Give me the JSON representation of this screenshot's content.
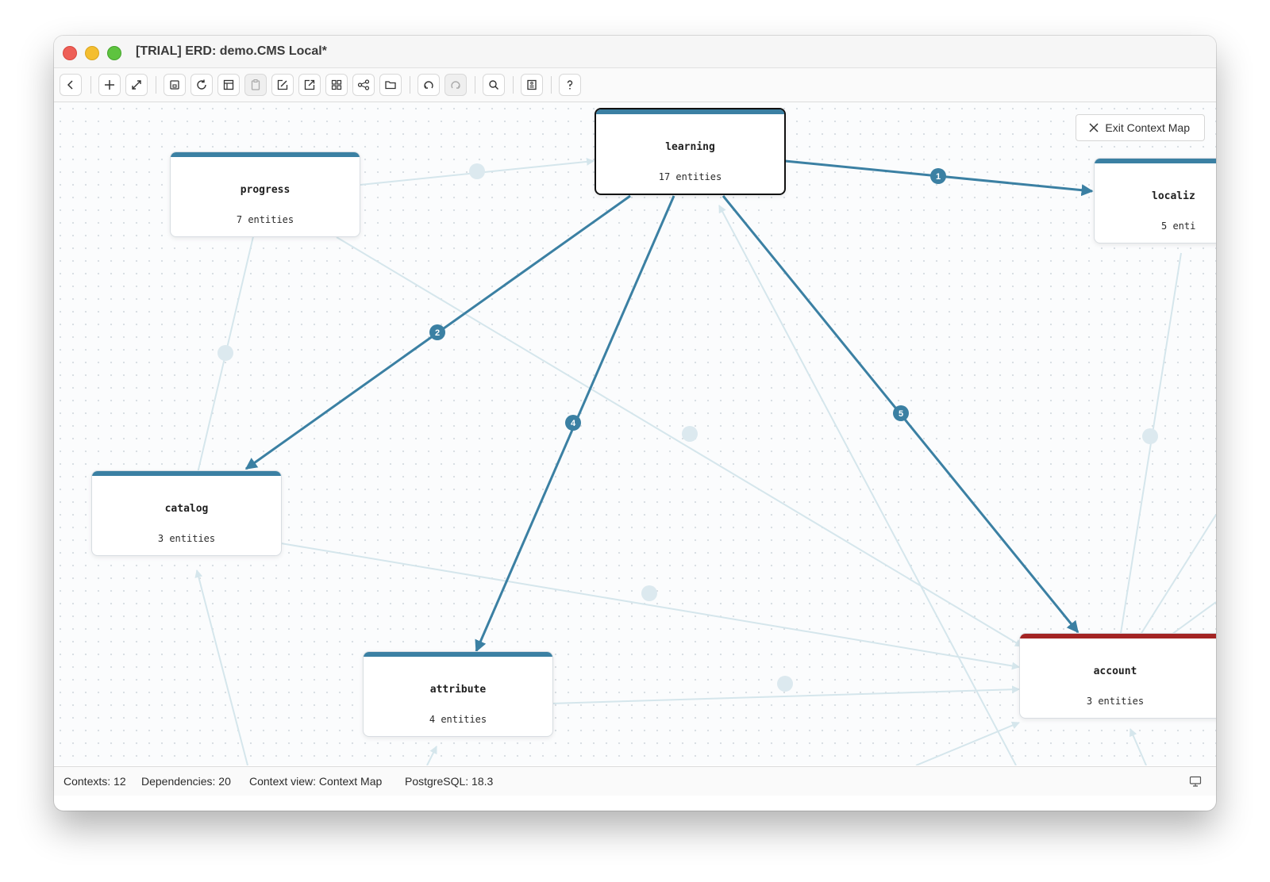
{
  "window": {
    "title": "[TRIAL] ERD: demo.CMS Local*"
  },
  "toolbar": {
    "buttons": [
      {
        "icon": "back-icon"
      },
      {
        "icon": "plus-icon"
      },
      {
        "icon": "link-icon"
      },
      {
        "icon": "save-icon"
      },
      {
        "icon": "refresh-icon"
      },
      {
        "icon": "layout-icon"
      },
      {
        "icon": "clipboard-icon",
        "disabled": true
      },
      {
        "icon": "edit-icon"
      },
      {
        "icon": "export-icon"
      },
      {
        "icon": "grid-icon"
      },
      {
        "icon": "graph-icon"
      },
      {
        "icon": "folder-icon"
      },
      {
        "icon": "undo-icon"
      },
      {
        "icon": "redo-icon",
        "disabled": true
      },
      {
        "icon": "search-icon"
      },
      {
        "icon": "document-icon"
      },
      {
        "icon": "help-icon"
      }
    ]
  },
  "canvas": {
    "exit_button_label": "Exit Context Map",
    "nodes": {
      "progress": {
        "name": "progress",
        "count": "7 entities"
      },
      "learning": {
        "name": "learning",
        "count": "17 entities"
      },
      "localization": {
        "name": "localiz",
        "count": "5 enti"
      },
      "catalog": {
        "name": "catalog",
        "count": "3 entities"
      },
      "attribute": {
        "name": "attribute",
        "count": "4 entities"
      },
      "account": {
        "name": "account",
        "count": "3 entities"
      }
    },
    "edge_labels": [
      "1",
      "2",
      "4",
      "5"
    ],
    "colors": {
      "accent": "#3b80a3",
      "account_bar": "#a32424",
      "faint_edge": "#d5e6ec"
    }
  },
  "status": {
    "contexts": "Contexts: 12",
    "dependencies": "Dependencies: 20",
    "context_view": "Context view: Context Map",
    "db": "PostgreSQL: 18.3"
  }
}
